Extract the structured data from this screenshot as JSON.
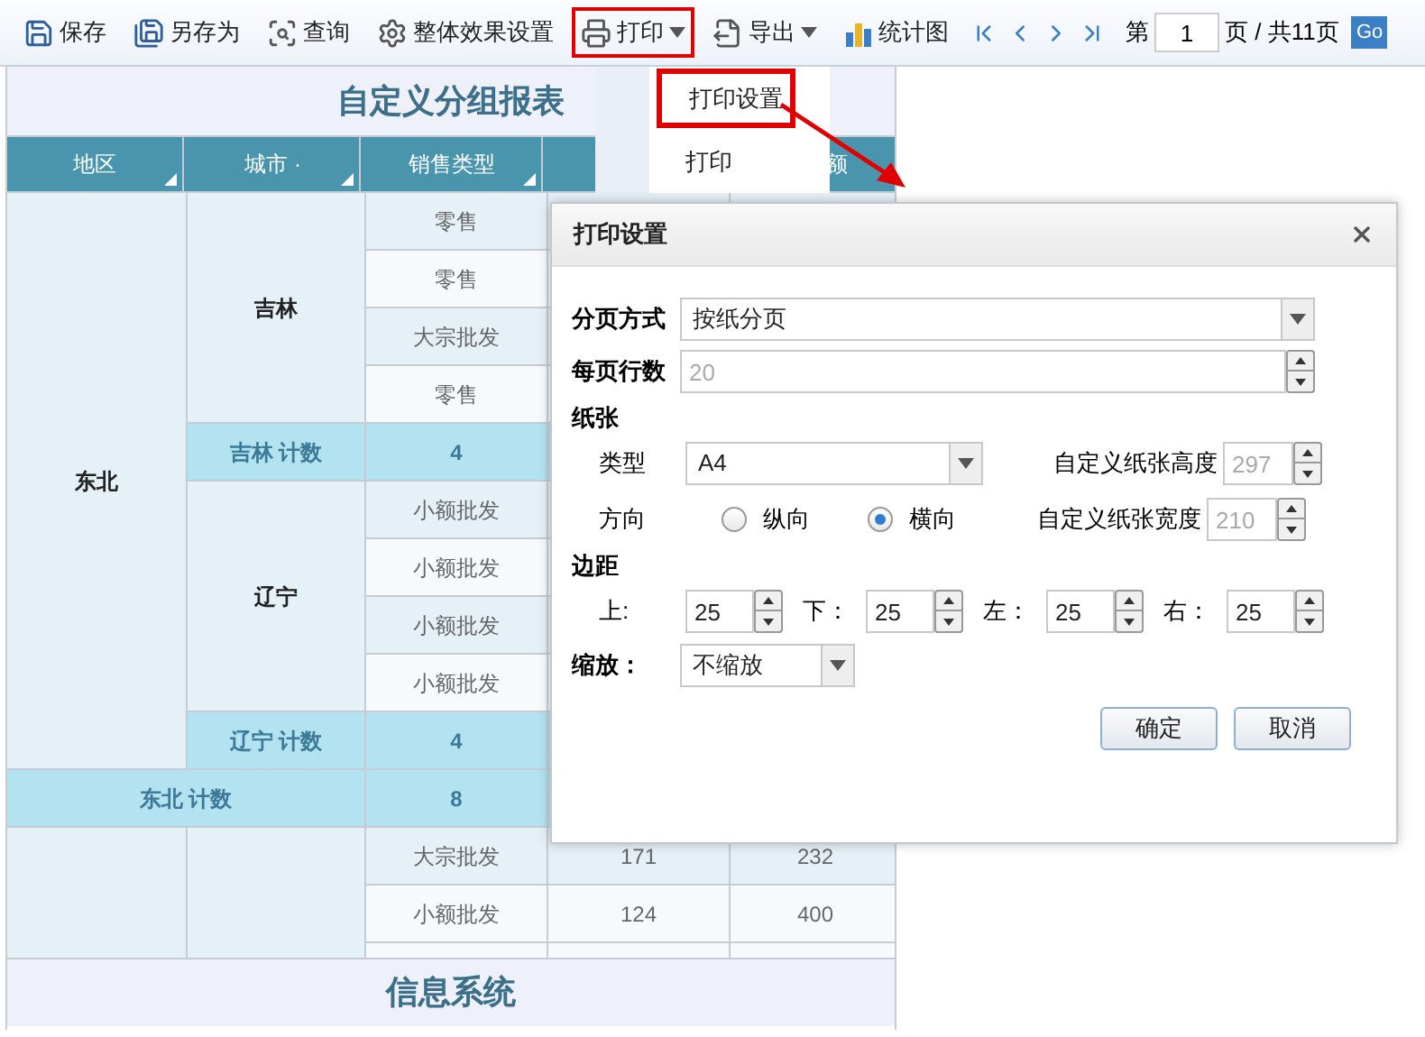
{
  "toolbar": {
    "buttons": [
      {
        "label": "保存",
        "kind": "save",
        "dropdown": false,
        "highlighted": false
      },
      {
        "label": "另存为",
        "kind": "saveas",
        "dropdown": false,
        "highlighted": false
      },
      {
        "label": "查询",
        "kind": "query",
        "dropdown": false,
        "highlighted": false
      },
      {
        "label": "整体效果设置",
        "kind": "settings",
        "dropdown": false,
        "highlighted": false
      },
      {
        "label": "打印",
        "kind": "print",
        "dropdown": true,
        "highlighted": true
      },
      {
        "label": "导出",
        "kind": "export",
        "dropdown": true,
        "highlighted": false
      },
      {
        "label": "统计图",
        "kind": "chart",
        "dropdown": false,
        "highlighted": false
      }
    ],
    "pager": {
      "prefix": "第",
      "page": "1",
      "suffix": "页 / 共11页",
      "go": "Go"
    }
  },
  "print_menu": {
    "items": [
      {
        "label": "打印设置",
        "highlighted": true
      },
      {
        "label": "打印",
        "highlighted": false
      }
    ]
  },
  "report": {
    "title": "自定义分组报表",
    "footer": "信息系统",
    "columns": [
      {
        "label": "地区",
        "corner": true
      },
      {
        "label": "城市 ·",
        "corner": true
      },
      {
        "label": "销售类型",
        "corner": true
      },
      {},
      {
        "label": "额",
        "corner": false
      }
    ],
    "regions": [
      {
        "name": "东北",
        "cities": [
          {
            "name": "吉林",
            "rows": [
              {
                "type": "零售"
              },
              {
                "type": "零售"
              },
              {
                "type": "大宗批发"
              },
              {
                "type": "零售"
              }
            ],
            "count_label": "吉林 计数",
            "count": "4"
          },
          {
            "name": "辽宁",
            "rows": [
              {
                "type": "小额批发"
              },
              {
                "type": "小额批发"
              },
              {
                "type": "小额批发"
              },
              {
                "type": "小额批发"
              }
            ],
            "count_label": "辽宁 计数",
            "count": "4"
          }
        ],
        "count_label": "东北 计数",
        "count": "8"
      },
      {
        "cities": [
          {
            "rows": [
              {
                "type": "大宗批发",
                "column_4": "171",
                "column_5": "232"
              },
              {
                "type": "小额批发",
                "column_4": "124",
                "column_5": "400"
              }
            ]
          }
        ]
      }
    ]
  },
  "dialog": {
    "title": "打印设置",
    "page_mode": {
      "label": "分页方式",
      "value": "按纸分页"
    },
    "rows_per_page": {
      "label": "每页行数",
      "value": "20",
      "disabled": true
    },
    "paper": {
      "heading": "纸张",
      "type_label": "类型",
      "type_value": "A4",
      "height_label": "自定义纸张高度",
      "height_value": "297",
      "height_disabled": true,
      "orientation_label": "方向",
      "orientations": [
        {
          "label": "纵向",
          "selected": false
        },
        {
          "label": "横向",
          "selected": true
        }
      ],
      "width_label": "自定义纸张宽度",
      "width_value": "210",
      "width_disabled": true
    },
    "margins": {
      "heading": "边距",
      "items": [
        {
          "label": "上:",
          "value": "25"
        },
        {
          "label": "下：",
          "value": "25"
        },
        {
          "label": "左：",
          "value": "25"
        },
        {
          "label": "右：",
          "value": "25"
        }
      ]
    },
    "scale": {
      "label": "缩放：",
      "value": "不缩放"
    },
    "buttons": [
      "确定",
      "取消"
    ]
  }
}
